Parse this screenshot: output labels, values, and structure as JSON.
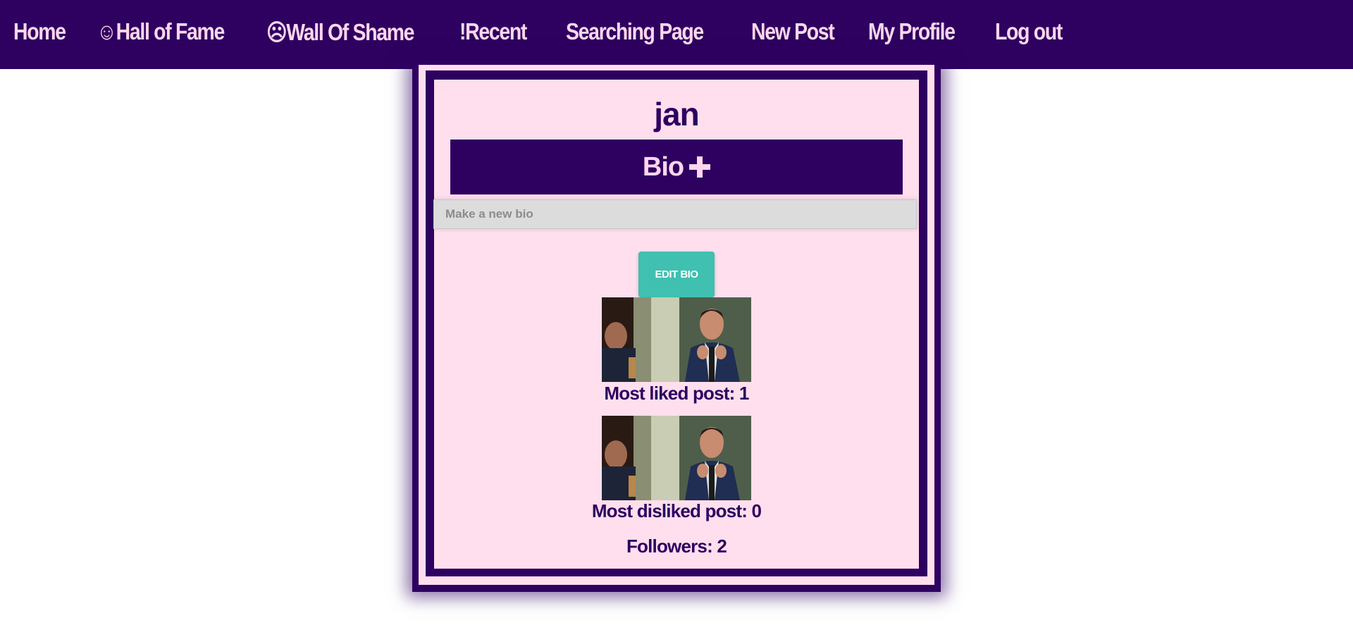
{
  "nav": {
    "home": "Home",
    "hall_of_fame": "☺Hall of Fame",
    "wall_of_shame": "☹Wall Of Shame",
    "recent": "!Recent",
    "searching": "Searching Page",
    "new_post": "New Post",
    "my_profile": "My Profile",
    "log_out": "Log out"
  },
  "profile": {
    "username": "jan",
    "bio_title": "Bio",
    "bio_icon": "plus-icon",
    "bio_placeholder": "Make a new bio",
    "bio_value": "",
    "edit_bio_label": "EDIT BIO",
    "most_liked_label": "Most liked post: 1",
    "most_disliked_label": "Most disliked post: 0",
    "followers_label": "Followers: 2"
  },
  "colors": {
    "brand_dark": "#2e0060",
    "brand_light": "#ffdfee",
    "nav_text": "#ffd6ec",
    "button_teal": "#3fc0b0"
  }
}
